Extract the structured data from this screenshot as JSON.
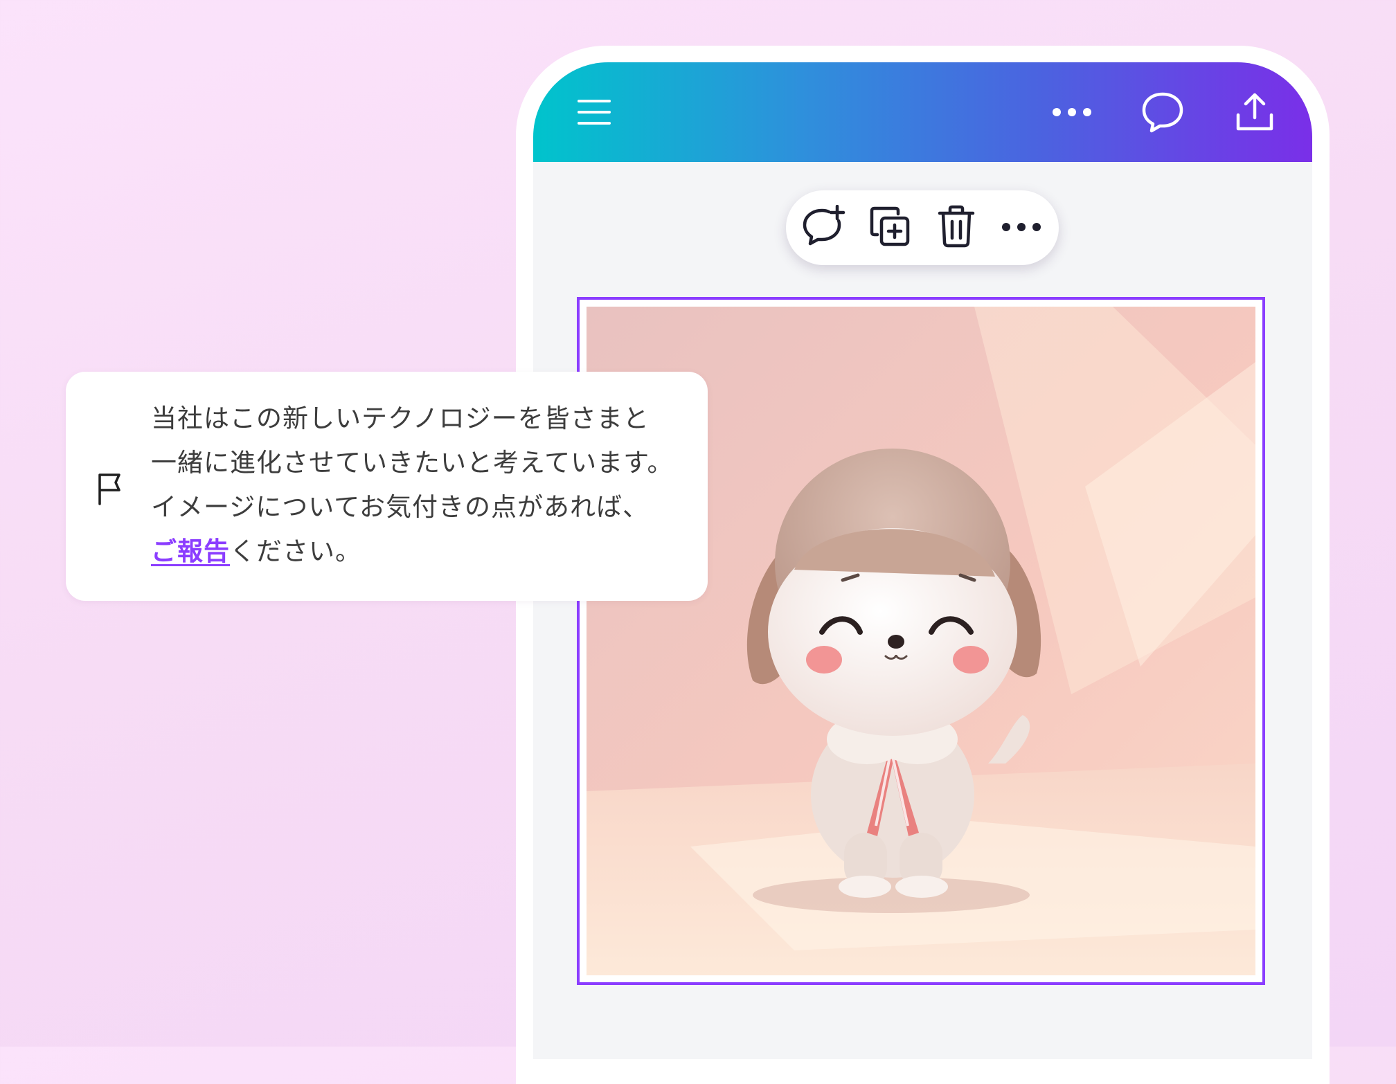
{
  "header": {
    "menu_icon": "hamburger-menu-icon",
    "more_icon": "more-horizontal-icon",
    "comment_icon": "comment-bubble-icon",
    "share_icon": "share-upload-icon",
    "gradient_start": "#00c4cc",
    "gradient_end": "#7a2fe8"
  },
  "toolbar": {
    "items": [
      {
        "icon": "add-comment-icon"
      },
      {
        "icon": "duplicate-icon"
      },
      {
        "icon": "trash-icon"
      },
      {
        "icon": "more-horizontal-icon"
      }
    ]
  },
  "canvas": {
    "selection_color": "#8b3dff",
    "image_subject": "cute-puppy-character"
  },
  "notice": {
    "icon": "flag-icon",
    "line1": "当社はこの新しいテクノロジーを皆さまと",
    "line2": "一緒に進化させていきたいと考えています。",
    "line3": "イメージについてお気付きの点があれば、",
    "link_text": "ご報告",
    "line4_suffix": "ください。",
    "link_color": "#8b3dff"
  }
}
